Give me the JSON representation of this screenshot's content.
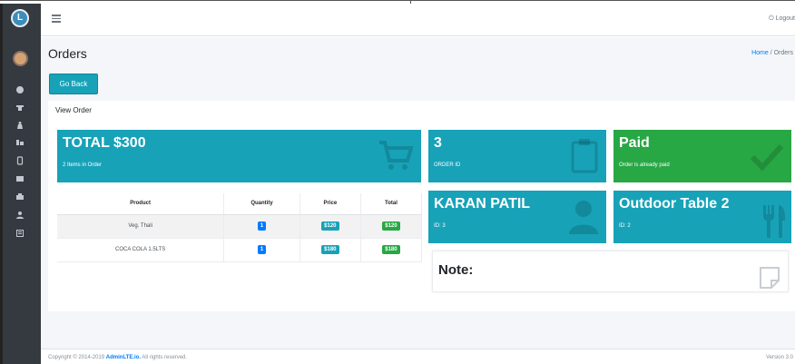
{
  "sidebar": {
    "logo_text": "L",
    "nav_icons": [
      "dashboard-icon",
      "orders-icon",
      "tables-icon",
      "products-icon",
      "categories-icon",
      "reports-icon",
      "kitchen-icon",
      "users-icon",
      "settings-icon"
    ]
  },
  "topbar": {
    "logout_label": "Logout"
  },
  "page": {
    "title": "Orders",
    "breadcrumb_home": "Home",
    "breadcrumb_sep": " / ",
    "breadcrumb_current": "Orders",
    "go_back_label": "Go Back",
    "card_header": "View Order"
  },
  "boxes": {
    "total": {
      "big": "TOTAL $300",
      "small": "2 Items in Order"
    },
    "order_id": {
      "big": "3",
      "small": "ORDER ID"
    },
    "paid": {
      "big": "Paid",
      "small": "Order is already paid"
    },
    "customer": {
      "big": "KARAN PATIL",
      "small": "ID: 3"
    },
    "table": {
      "big": "Outdoor Table 2",
      "small": "ID: 2"
    }
  },
  "items_table": {
    "headers": [
      "Product",
      "Quantity",
      "Price",
      "Total"
    ],
    "rows": [
      {
        "product": "Veg. Thali",
        "quantity": "1",
        "price": "$120",
        "total": "$120"
      },
      {
        "product": "COCA COLA 1.5LTS",
        "quantity": "1",
        "price": "$180",
        "total": "$180"
      }
    ]
  },
  "note": {
    "label": "Note:"
  },
  "footer": {
    "copyright_prefix": "Copyright © 2014-2019 ",
    "brand": "AdminLTE.io.",
    "copyright_suffix": " All rights reserved.",
    "version": "Version 3.0"
  },
  "colors": {
    "info": "#17a2b8",
    "success": "#28a745",
    "sidebar": "#343a40",
    "primary": "#007bff"
  }
}
